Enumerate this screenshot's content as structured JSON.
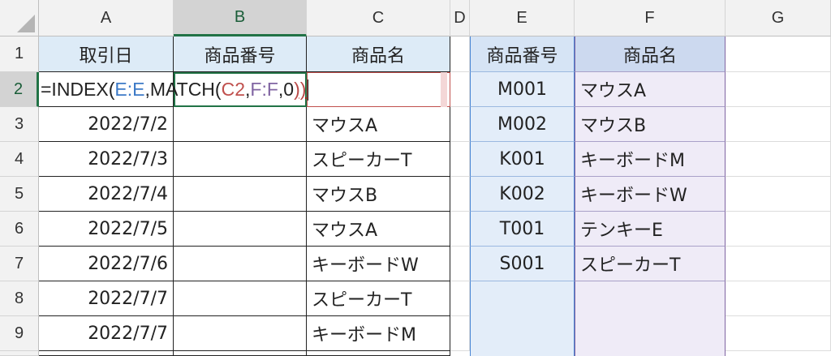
{
  "columns": [
    "A",
    "B",
    "C",
    "D",
    "E",
    "F",
    "G"
  ],
  "selected_column": "B",
  "rows": [
    "1",
    "2",
    "3",
    "4",
    "5",
    "6",
    "7",
    "8",
    "9"
  ],
  "selected_row": "2",
  "table1": {
    "headers": [
      "取引日",
      "商品番号",
      "商品名"
    ],
    "rows": [
      {
        "date": "2022/7/2",
        "product_no": "",
        "product_name": "マウスA"
      },
      {
        "date": "2022/7/3",
        "product_no": "",
        "product_name": "スピーカーT"
      },
      {
        "date": "2022/7/4",
        "product_no": "",
        "product_name": "マウスB"
      },
      {
        "date": "2022/7/5",
        "product_no": "",
        "product_name": "マウスA"
      },
      {
        "date": "2022/7/6",
        "product_no": "",
        "product_name": "キーボードW"
      },
      {
        "date": "2022/7/7",
        "product_no": "",
        "product_name": "スピーカーT"
      },
      {
        "date": "2022/7/7",
        "product_no": "",
        "product_name": "キーボードM"
      }
    ]
  },
  "formula": {
    "p1": "=INDEX(",
    "ref_e": "E:E",
    "p2": ",MATCH(",
    "ref_c": "C2",
    "comma1": ",",
    "ref_f": "F:F",
    "p3": ",0",
    "close": "))"
  },
  "table2": {
    "headers": [
      "商品番号",
      "商品名"
    ],
    "rows": [
      {
        "product_no": "M001",
        "product_name": "マウスA"
      },
      {
        "product_no": "M002",
        "product_name": "マウスB"
      },
      {
        "product_no": "K001",
        "product_name": "キーボードM"
      },
      {
        "product_no": "K002",
        "product_name": "キーボードW"
      },
      {
        "product_no": "T001",
        "product_name": "テンキーE"
      },
      {
        "product_no": "S001",
        "product_name": "スピーカーT"
      },
      {
        "product_no": "",
        "product_name": ""
      },
      {
        "product_no": "",
        "product_name": ""
      }
    ]
  },
  "colors": {
    "accent_green": "#217346",
    "header_blue": "#ddebf7",
    "header_lavender": "#ccd9ef",
    "ref_e_color": "#3d7ac7",
    "ref_c_color": "#c0504d",
    "ref_f_color": "#8064a2"
  }
}
